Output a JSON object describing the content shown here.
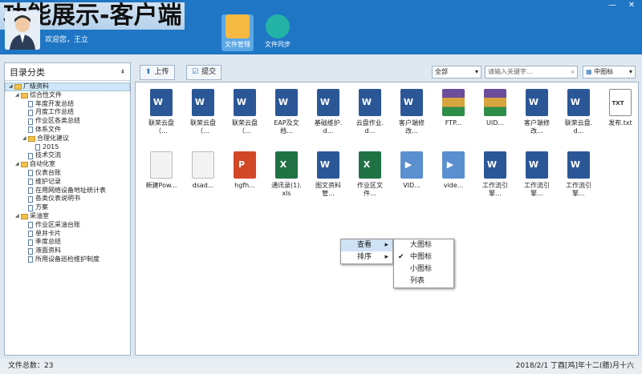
{
  "header": {
    "banner": "功能展示-客户端",
    "welcome": "欢迎您，王立",
    "buttons": [
      {
        "label": "文件管理",
        "icon": "folder-icon"
      },
      {
        "label": "文件同步",
        "icon": "sync-icon"
      }
    ]
  },
  "sidebar": {
    "title": "目录分类",
    "tree": [
      {
        "label": "厂级资料",
        "level": 0,
        "type": "folder",
        "expanded": true,
        "selected": true
      },
      {
        "label": "综合性文件",
        "level": 1,
        "type": "folder",
        "expanded": true
      },
      {
        "label": "年度开发总结",
        "level": 2,
        "type": "doc"
      },
      {
        "label": "月度工作总结",
        "level": 2,
        "type": "doc"
      },
      {
        "label": "作业区各类总结",
        "level": 2,
        "type": "doc"
      },
      {
        "label": "体系文件",
        "level": 2,
        "type": "doc"
      },
      {
        "label": "合理化建议",
        "level": 2,
        "type": "folder",
        "expanded": true
      },
      {
        "label": "2015",
        "level": 3,
        "type": "doc"
      },
      {
        "label": "技术交流",
        "level": 2,
        "type": "doc"
      },
      {
        "label": "自动化室",
        "level": 1,
        "type": "folder",
        "expanded": true
      },
      {
        "label": "仪表台账",
        "level": 2,
        "type": "doc"
      },
      {
        "label": "维护记录",
        "level": 2,
        "type": "doc"
      },
      {
        "label": "在用网络设备地址统计表",
        "level": 2,
        "type": "doc"
      },
      {
        "label": "各类仪表说明书",
        "level": 2,
        "type": "doc"
      },
      {
        "label": "方案",
        "level": 2,
        "type": "doc"
      },
      {
        "label": "采油室",
        "level": 1,
        "type": "folder",
        "expanded": true
      },
      {
        "label": "作业区采油台账",
        "level": 2,
        "type": "doc"
      },
      {
        "label": "单井卡片",
        "level": 2,
        "type": "doc"
      },
      {
        "label": "季度总结",
        "level": 2,
        "type": "doc"
      },
      {
        "label": "液面资料",
        "level": 2,
        "type": "doc"
      },
      {
        "label": "所用设备巡检维护制度",
        "level": 2,
        "type": "doc"
      }
    ]
  },
  "toolbar": {
    "upload": "上传",
    "submit": "提交",
    "filter": "全部",
    "search_placeholder": "请输入关键字...",
    "view": "中图标"
  },
  "files": [
    {
      "name": "联荣云盘（...",
      "kind": "word"
    },
    {
      "name": "联荣云盘（...",
      "kind": "word"
    },
    {
      "name": "联荣云盘（...",
      "kind": "word"
    },
    {
      "name": "EAP及文档...",
      "kind": "word"
    },
    {
      "name": "基础维护.d...",
      "kind": "word"
    },
    {
      "name": "云盘作业.d...",
      "kind": "word"
    },
    {
      "name": "客户端修改...",
      "kind": "word"
    },
    {
      "name": "FTP...",
      "kind": "rar"
    },
    {
      "name": "UID...",
      "kind": "rar"
    },
    {
      "name": "客户端修改...",
      "kind": "word"
    },
    {
      "name": "联荣云盘.d...",
      "kind": "word"
    },
    {
      "name": "发布.txt",
      "kind": "txt"
    },
    {
      "name": "新建Pow...",
      "kind": "blank"
    },
    {
      "name": "dsad...",
      "kind": "blank"
    },
    {
      "name": "hgfh...",
      "kind": "ppt"
    },
    {
      "name": "通讯录(1).xls",
      "kind": "excel"
    },
    {
      "name": "图文资料管...",
      "kind": "word"
    },
    {
      "name": "作业区文件...",
      "kind": "excel"
    },
    {
      "name": "VID...",
      "kind": "mov"
    },
    {
      "name": "vide...",
      "kind": "mov"
    },
    {
      "name": "工作流引擎...",
      "kind": "word"
    },
    {
      "name": "工作流引擎...",
      "kind": "word"
    },
    {
      "name": "工作流引擎...",
      "kind": "word"
    }
  ],
  "context_menu": {
    "main": [
      {
        "label": "查看",
        "highlighted": true
      },
      {
        "label": "排序",
        "highlighted": false
      }
    ],
    "sub": [
      {
        "label": "大图标",
        "checked": false
      },
      {
        "label": "中图标",
        "checked": true
      },
      {
        "label": "小图标",
        "checked": false
      },
      {
        "label": "列表",
        "checked": false
      }
    ]
  },
  "status": {
    "total": "文件总数：23",
    "date": "2018/2/1 丁酉[鸡]年十二(腊)月十六"
  }
}
